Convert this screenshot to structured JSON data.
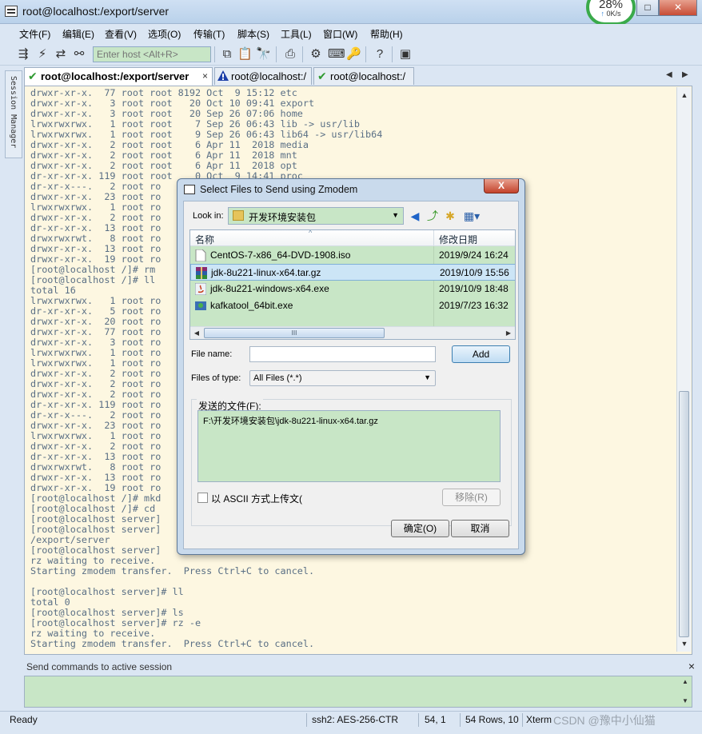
{
  "window": {
    "title": "root@localhost:/export/server",
    "speed_percent": "28%",
    "speed_rate": "0K/s"
  },
  "menu": [
    "文件(F)",
    "编辑(E)",
    "查看(V)",
    "选项(O)",
    "传输(T)",
    "脚本(S)",
    "工具(L)",
    "窗口(W)",
    "帮助(H)"
  ],
  "toolbar": {
    "host_placeholder": "Enter host <Alt+R>"
  },
  "session_manager": "Session Manager",
  "tabs": [
    {
      "label": "root@localhost:/export/server",
      "status": "ok",
      "active": true,
      "close": "×"
    },
    {
      "label": "root@localhost:/",
      "status": "warning",
      "active": false
    },
    {
      "label": "root@localhost:/",
      "status": "ok",
      "active": false
    }
  ],
  "terminal_lines": [
    "drwxr-xr-x.  77 root root 8192 Oct  9 15:12 etc",
    "drwxr-xr-x.   3 root root   20 Oct 10 09:41 export",
    "drwxr-xr-x.   3 root root   20 Sep 26 07:06 home",
    "lrwxrwxrwx.   1 root root    7 Sep 26 06:43 lib -> usr/lib",
    "lrwxrwxrwx.   1 root root    9 Sep 26 06:43 lib64 -> usr/lib64",
    "drwxr-xr-x.   2 root root    6 Apr 11  2018 media",
    "drwxr-xr-x.   2 root root    6 Apr 11  2018 mnt",
    "drwxr-xr-x.   2 root root    6 Apr 11  2018 opt",
    "dr-xr-xr-x. 119 root root    0 Oct  9 14:41 proc",
    "dr-xr-x---.   2 root ro",
    "drwxr-xr-x.  23 root ro",
    "lrwxrwxrwx.   1 root ro",
    "drwxr-xr-x.   2 root ro",
    "dr-xr-xr-x.  13 root ro",
    "drwxrwxrwt.   8 root ro",
    "drwxr-xr-x.  13 root ro",
    "drwxr-xr-x.  19 root ro",
    "[root@localhost /]# rm",
    "[root@localhost /]# ll",
    "total 16",
    "lrwxrwxrwx.   1 root ro",
    "dr-xr-xr-x.   5 root ro",
    "drwxr-xr-x.  20 root ro",
    "drwxr-xr-x.  77 root ro",
    "drwxr-xr-x.   3 root ro",
    "lrwxrwxrwx.   1 root ro",
    "lrwxrwxrwx.   1 root ro",
    "drwxr-xr-x.   2 root ro",
    "drwxr-xr-x.   2 root ro",
    "drwxr-xr-x.   2 root ro",
    "dr-xr-xr-x. 119 root ro",
    "dr-xr-x---.   2 root ro",
    "drwxr-xr-x.  23 root ro",
    "lrwxrwxrwx.   1 root ro",
    "drwxr-xr-x.   2 root ro",
    "dr-xr-xr-x.  13 root ro",
    "drwxrwxrwt.   8 root ro",
    "drwxr-xr-x.  13 root ro",
    "drwxr-xr-x.  19 root ro",
    "[root@localhost /]# mkd",
    "[root@localhost /]# cd",
    "[root@localhost server]",
    "[root@localhost server]",
    "/export/server",
    "[root@localhost server]",
    "rz waiting to receive.",
    "Starting zmodem transfer.  Press Ctrl+C to cancel.",
    "",
    "[root@localhost server]# ll",
    "total 0",
    "[root@localhost server]# ls",
    "[root@localhost server]# rz -e",
    "rz waiting to receive.",
    "Starting zmodem transfer.  Press Ctrl+C to cancel."
  ],
  "command_bar": {
    "label": "Send commands to active session",
    "close": "×"
  },
  "status": {
    "ready": "Ready",
    "cipher": "ssh2: AES-256-CTR",
    "position": "54,   1",
    "rows": "54 Rows, 10",
    "term": "Xterm",
    "watermark": "CSDN @豫中小仙猫"
  },
  "dialog": {
    "title": "Select Files to Send using Zmodem",
    "close": "X",
    "look_in_label": "Look in:",
    "look_in_value": "开发环境安装包",
    "columns": {
      "name": "名称",
      "date": "修改日期"
    },
    "files": [
      {
        "name": "CentOS-7-x86_64-DVD-1908.iso",
        "date": "2019/9/24 16:24",
        "icon": "disc-image-icon",
        "selected": false
      },
      {
        "name": "jdk-8u221-linux-x64.tar.gz",
        "date": "2019/10/9 15:56",
        "icon": "archive-icon",
        "selected": true
      },
      {
        "name": "jdk-8u221-windows-x64.exe",
        "date": "2019/10/9 18:48",
        "icon": "java-installer-icon",
        "selected": false
      },
      {
        "name": "kafkatool_64bit.exe",
        "date": "2019/7/23 16:32",
        "icon": "app-installer-icon",
        "selected": false
      }
    ],
    "hscroll_thumb": "III",
    "file_name_label": "File name:",
    "file_name_value": "",
    "add_label": "Add",
    "file_type_label": "Files of type:",
    "file_type_value": "All Files (*.*)",
    "send_group_label": "发送的文件(F):",
    "send_files": [
      "F:\\开发环境安装包\\jdk-8u221-linux-x64.tar.gz"
    ],
    "ascii_label": "以 ASCII 方式上传文(",
    "remove_label": "移除(R)",
    "ok_label": "确定(O)",
    "cancel_label": "取消"
  }
}
